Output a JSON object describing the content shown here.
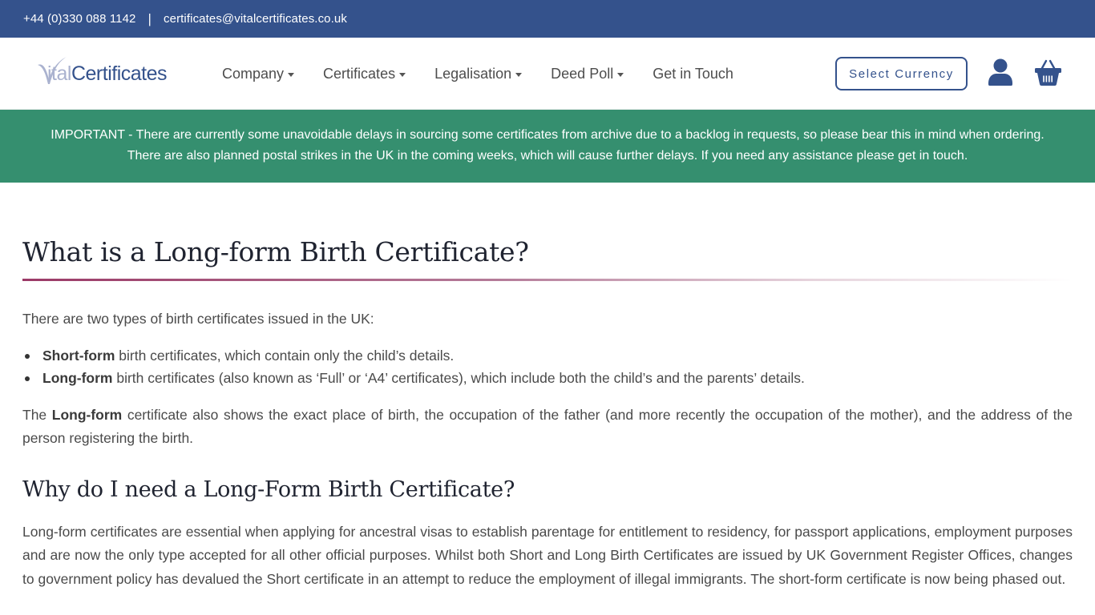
{
  "topbar": {
    "phone": "+44 (0)330 088 1142",
    "separator": "|",
    "email": "certificates@vitalcertificates.co.uk"
  },
  "logo": {
    "part1": "Vital",
    "part2": "Certificates"
  },
  "nav": {
    "items": [
      {
        "label": "Company",
        "has_dropdown": true
      },
      {
        "label": "Certificates",
        "has_dropdown": true
      },
      {
        "label": "Legalisation",
        "has_dropdown": true
      },
      {
        "label": "Deed Poll",
        "has_dropdown": true
      },
      {
        "label": "Get in Touch",
        "has_dropdown": false
      }
    ]
  },
  "header_actions": {
    "currency_label": "Select Currency",
    "account_icon": "user-icon",
    "basket_icon": "basket-icon"
  },
  "notice": {
    "line1": "IMPORTANT - There are currently some unavoidable delays in sourcing some certificates from archive due to a backlog in requests, so please bear this in mind when ordering.",
    "line2": "There are also planned postal strikes in the UK in the coming weeks, which will cause further delays. If you need any assistance please get in touch.",
    "bg_color": "#358f6f"
  },
  "content": {
    "title": "What is a Long-form Birth Certificate?",
    "intro": "There are two types of birth certificates issued in the UK:",
    "types": [
      {
        "bold": "Short-form",
        "text": " birth certificates, which contain only the child’s details."
      },
      {
        "bold": "Long-form",
        "text": " birth certificates (also known as ‘Full’ or ‘A4’ certificates), which include both the child’s and the parents’ details."
      }
    ],
    "para2": {
      "pre": "The ",
      "bold": "Long-form",
      "post": " certificate also shows the exact place of birth, the occupation of the father (and more recently the occupation of the mother), and the address of the person registering the birth."
    },
    "section_title": "Why do I need a Long-Form Birth Certificate?",
    "para3": "Long-form certificates are essential when applying for ancestral visas to establish parentage for entitlement to residency, for passport applications, employment purposes and are now the only type accepted for all other official purposes. Whilst both Short and Long Birth Certificates are issued by UK Government Register Offices, changes to government policy has devalued the Short certificate in an attempt to reduce the employment of illegal immigrants. The short-form certificate is now being phased out."
  },
  "colors": {
    "brand_blue": "#34528c",
    "accent_green": "#358f6f",
    "rule_magenta": "#9b3a67"
  }
}
